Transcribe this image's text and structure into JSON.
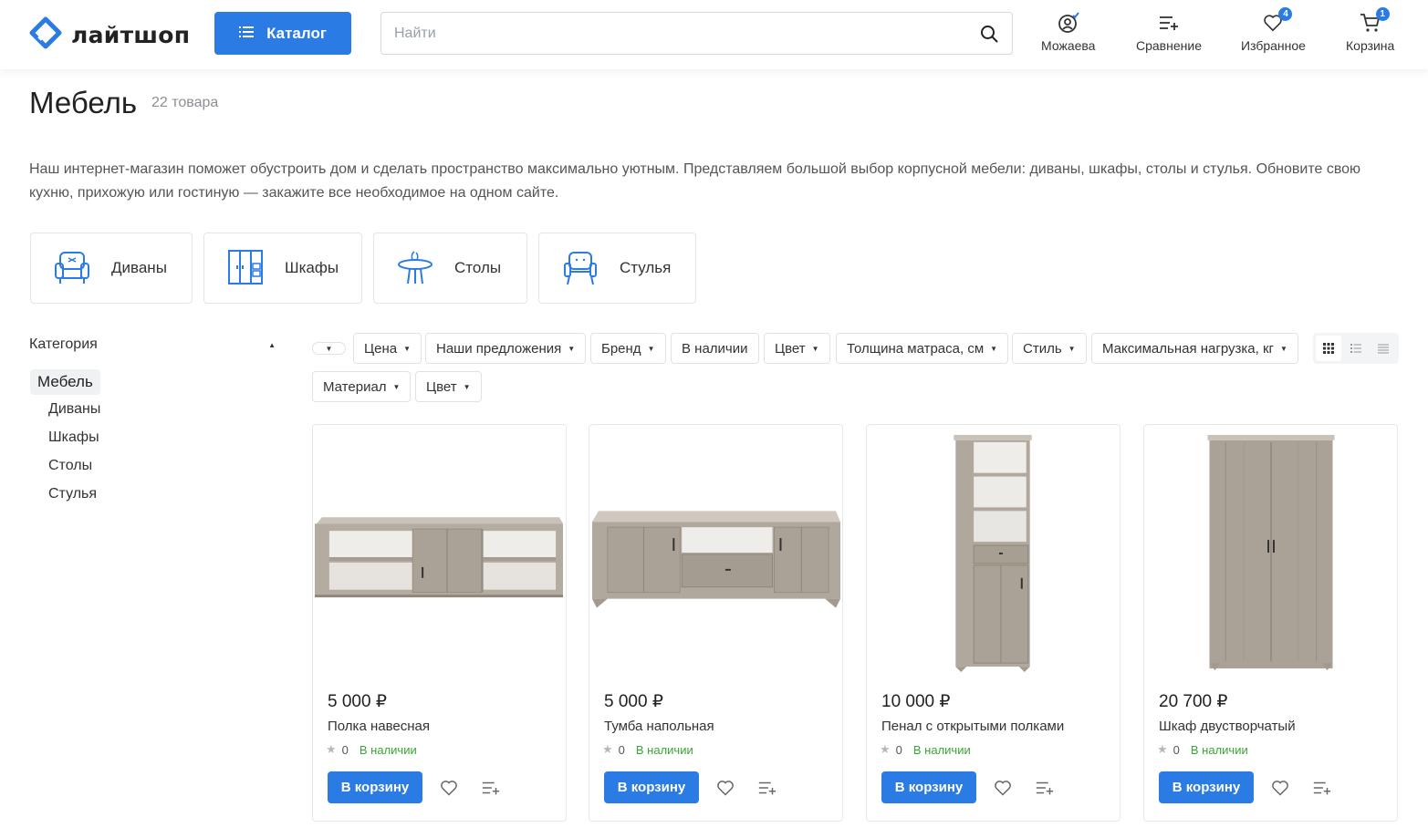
{
  "colors": {
    "accent": "#2a7be4",
    "in_stock": "#3aa535",
    "muted": "#8b8f94"
  },
  "header": {
    "logo_text": "лайтшоп",
    "catalog_label": "Каталог",
    "search_placeholder": "Найти",
    "items": [
      {
        "label": "Можаева",
        "icon": "user-icon"
      },
      {
        "label": "Сравнение",
        "icon": "compare-icon"
      },
      {
        "label": "Избранное",
        "icon": "heart-icon",
        "badge": "4"
      },
      {
        "label": "Корзина",
        "icon": "cart-icon",
        "badge": "1"
      }
    ]
  },
  "page": {
    "title": "Мебель",
    "count": "22 товара",
    "description": "Наш интернет-магазин поможет обустроить дом и сделать пространство максимально уютным. Представляем большой выбор корпусной мебели: диваны, шкафы, столы и стулья. Обновите свою кухню, прихожую или гостиную — закажите все необходимое на одном сайте."
  },
  "tiles": [
    {
      "label": "Диваны",
      "icon": "armchair-icon"
    },
    {
      "label": "Шкафы",
      "icon": "wardrobe-icon"
    },
    {
      "label": "Столы",
      "icon": "table-icon"
    },
    {
      "label": "Стулья",
      "icon": "chair-icon"
    }
  ],
  "sidebar": {
    "heading": "Категория",
    "active": "Мебель",
    "items": [
      "Диваны",
      "Шкафы",
      "Столы",
      "Стулья"
    ]
  },
  "filters": {
    "row1": [
      "",
      "Цена",
      "Наши предложения",
      "Бренд",
      "В наличии",
      "Цвет",
      "Толщина матраса, см",
      "Стиль",
      "Максимальная нагрузка, кг"
    ],
    "row2": [
      "Материал",
      "Цвет"
    ]
  },
  "products": [
    {
      "price": "5 000 ₽",
      "name": "Полка навесная",
      "rating": "0",
      "stock": "В наличии",
      "button": "В корзину"
    },
    {
      "price": "5 000 ₽",
      "name": "Тумба напольная",
      "rating": "0",
      "stock": "В наличии",
      "button": "В корзину"
    },
    {
      "price": "10 000 ₽",
      "name": "Пенал с открытыми полками",
      "rating": "0",
      "stock": "В наличии",
      "button": "В корзину"
    },
    {
      "price": "20 700 ₽",
      "name": "Шкаф двустворчатый",
      "rating": "0",
      "stock": "В наличии",
      "button": "В корзину"
    }
  ]
}
